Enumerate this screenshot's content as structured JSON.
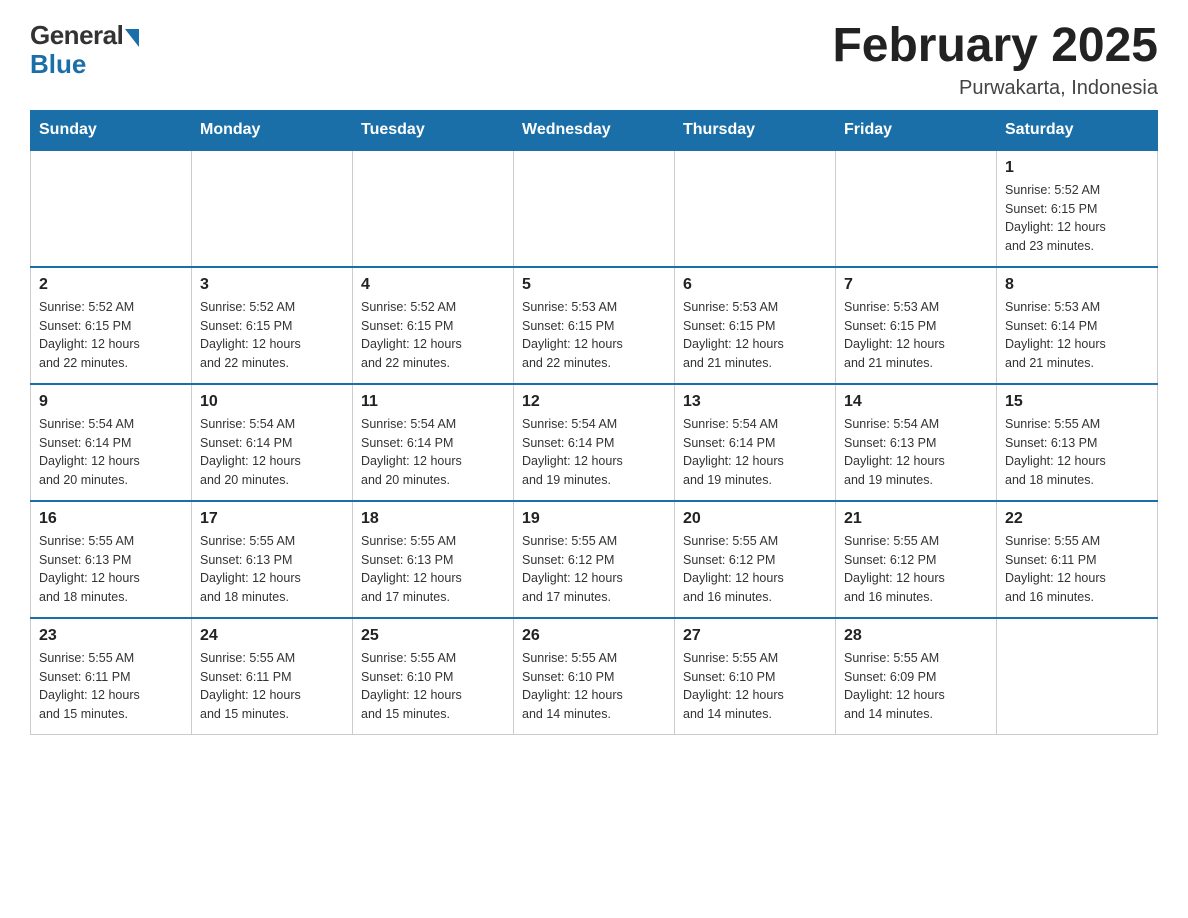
{
  "header": {
    "logo_general": "General",
    "logo_blue": "Blue",
    "month_title": "February 2025",
    "location": "Purwakarta, Indonesia"
  },
  "days_of_week": [
    "Sunday",
    "Monday",
    "Tuesday",
    "Wednesday",
    "Thursday",
    "Friday",
    "Saturday"
  ],
  "weeks": [
    {
      "days": [
        {
          "number": "",
          "info": ""
        },
        {
          "number": "",
          "info": ""
        },
        {
          "number": "",
          "info": ""
        },
        {
          "number": "",
          "info": ""
        },
        {
          "number": "",
          "info": ""
        },
        {
          "number": "",
          "info": ""
        },
        {
          "number": "1",
          "info": "Sunrise: 5:52 AM\nSunset: 6:15 PM\nDaylight: 12 hours\nand 23 minutes."
        }
      ]
    },
    {
      "days": [
        {
          "number": "2",
          "info": "Sunrise: 5:52 AM\nSunset: 6:15 PM\nDaylight: 12 hours\nand 22 minutes."
        },
        {
          "number": "3",
          "info": "Sunrise: 5:52 AM\nSunset: 6:15 PM\nDaylight: 12 hours\nand 22 minutes."
        },
        {
          "number": "4",
          "info": "Sunrise: 5:52 AM\nSunset: 6:15 PM\nDaylight: 12 hours\nand 22 minutes."
        },
        {
          "number": "5",
          "info": "Sunrise: 5:53 AM\nSunset: 6:15 PM\nDaylight: 12 hours\nand 22 minutes."
        },
        {
          "number": "6",
          "info": "Sunrise: 5:53 AM\nSunset: 6:15 PM\nDaylight: 12 hours\nand 21 minutes."
        },
        {
          "number": "7",
          "info": "Sunrise: 5:53 AM\nSunset: 6:15 PM\nDaylight: 12 hours\nand 21 minutes."
        },
        {
          "number": "8",
          "info": "Sunrise: 5:53 AM\nSunset: 6:14 PM\nDaylight: 12 hours\nand 21 minutes."
        }
      ]
    },
    {
      "days": [
        {
          "number": "9",
          "info": "Sunrise: 5:54 AM\nSunset: 6:14 PM\nDaylight: 12 hours\nand 20 minutes."
        },
        {
          "number": "10",
          "info": "Sunrise: 5:54 AM\nSunset: 6:14 PM\nDaylight: 12 hours\nand 20 minutes."
        },
        {
          "number": "11",
          "info": "Sunrise: 5:54 AM\nSunset: 6:14 PM\nDaylight: 12 hours\nand 20 minutes."
        },
        {
          "number": "12",
          "info": "Sunrise: 5:54 AM\nSunset: 6:14 PM\nDaylight: 12 hours\nand 19 minutes."
        },
        {
          "number": "13",
          "info": "Sunrise: 5:54 AM\nSunset: 6:14 PM\nDaylight: 12 hours\nand 19 minutes."
        },
        {
          "number": "14",
          "info": "Sunrise: 5:54 AM\nSunset: 6:13 PM\nDaylight: 12 hours\nand 19 minutes."
        },
        {
          "number": "15",
          "info": "Sunrise: 5:55 AM\nSunset: 6:13 PM\nDaylight: 12 hours\nand 18 minutes."
        }
      ]
    },
    {
      "days": [
        {
          "number": "16",
          "info": "Sunrise: 5:55 AM\nSunset: 6:13 PM\nDaylight: 12 hours\nand 18 minutes."
        },
        {
          "number": "17",
          "info": "Sunrise: 5:55 AM\nSunset: 6:13 PM\nDaylight: 12 hours\nand 18 minutes."
        },
        {
          "number": "18",
          "info": "Sunrise: 5:55 AM\nSunset: 6:13 PM\nDaylight: 12 hours\nand 17 minutes."
        },
        {
          "number": "19",
          "info": "Sunrise: 5:55 AM\nSunset: 6:12 PM\nDaylight: 12 hours\nand 17 minutes."
        },
        {
          "number": "20",
          "info": "Sunrise: 5:55 AM\nSunset: 6:12 PM\nDaylight: 12 hours\nand 16 minutes."
        },
        {
          "number": "21",
          "info": "Sunrise: 5:55 AM\nSunset: 6:12 PM\nDaylight: 12 hours\nand 16 minutes."
        },
        {
          "number": "22",
          "info": "Sunrise: 5:55 AM\nSunset: 6:11 PM\nDaylight: 12 hours\nand 16 minutes."
        }
      ]
    },
    {
      "days": [
        {
          "number": "23",
          "info": "Sunrise: 5:55 AM\nSunset: 6:11 PM\nDaylight: 12 hours\nand 15 minutes."
        },
        {
          "number": "24",
          "info": "Sunrise: 5:55 AM\nSunset: 6:11 PM\nDaylight: 12 hours\nand 15 minutes."
        },
        {
          "number": "25",
          "info": "Sunrise: 5:55 AM\nSunset: 6:10 PM\nDaylight: 12 hours\nand 15 minutes."
        },
        {
          "number": "26",
          "info": "Sunrise: 5:55 AM\nSunset: 6:10 PM\nDaylight: 12 hours\nand 14 minutes."
        },
        {
          "number": "27",
          "info": "Sunrise: 5:55 AM\nSunset: 6:10 PM\nDaylight: 12 hours\nand 14 minutes."
        },
        {
          "number": "28",
          "info": "Sunrise: 5:55 AM\nSunset: 6:09 PM\nDaylight: 12 hours\nand 14 minutes."
        },
        {
          "number": "",
          "info": ""
        }
      ]
    }
  ]
}
